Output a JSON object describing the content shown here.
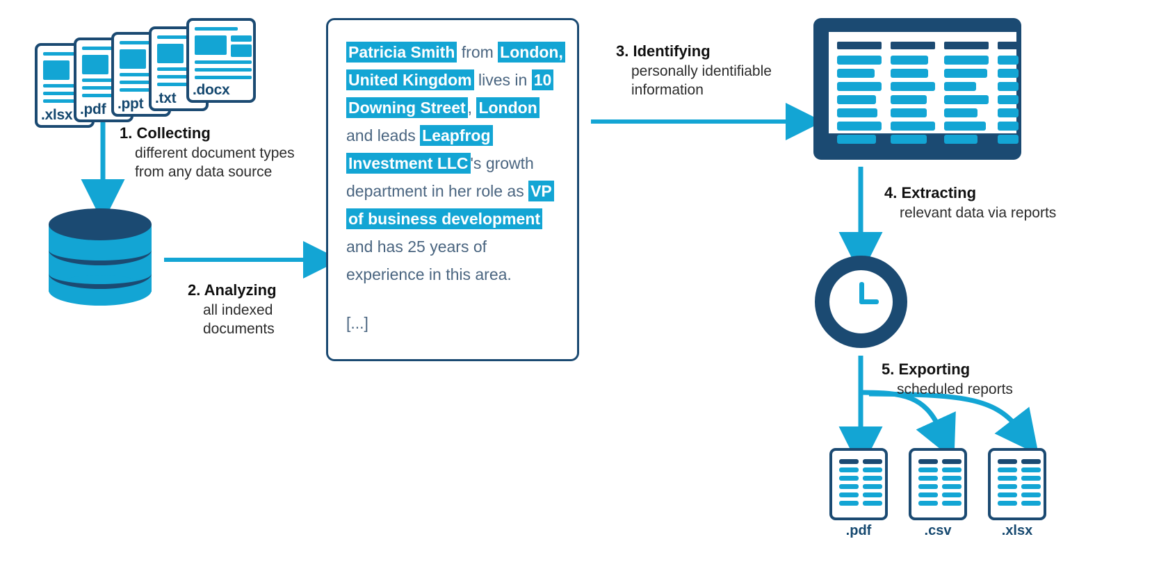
{
  "title": "Document data extraction pipeline",
  "colors": {
    "dark_blue": "#1b4a72",
    "light_blue": "#13a5d4",
    "text_dark": "#101010",
    "text_body": "#4a6580",
    "white": "#ffffff"
  },
  "input_documents": {
    "label": "document type stack",
    "files": [
      {
        "ext": ".xlsx"
      },
      {
        "ext": ".pdf"
      },
      {
        "ext": ".ppt"
      },
      {
        "ext": ".txt"
      },
      {
        "ext": ".docx"
      }
    ]
  },
  "database": {
    "label": "data source database"
  },
  "steps": [
    {
      "id": "collecting",
      "number": "1.",
      "title": "1. Collecting",
      "desc": "different document types\nfrom any data source"
    },
    {
      "id": "analyzing",
      "number": "2.",
      "title": "2. Analyzing",
      "desc": "all indexed\ndocuments"
    },
    {
      "id": "identifying",
      "number": "3.",
      "title": "3. Identifying",
      "desc": "personally identifiable\ninformation"
    },
    {
      "id": "extracting",
      "number": "4.",
      "title": "4. Extracting",
      "desc": "relevant data via reports"
    },
    {
      "id": "exporting",
      "number": "5.",
      "title": "5. Exporting",
      "desc": "scheduled reports"
    }
  ],
  "document_card": {
    "segments": [
      {
        "text": "Patricia Smith",
        "highlight": true
      },
      {
        "text": " from ",
        "highlight": false
      },
      {
        "text": "London, United Kingdom",
        "highlight": true
      },
      {
        "text": " lives in ",
        "highlight": false
      },
      {
        "text": "10 Downing Street",
        "highlight": true
      },
      {
        "text": ", ",
        "highlight": false
      },
      {
        "text": "London",
        "highlight": true
      },
      {
        "text": " and leads ",
        "highlight": false
      },
      {
        "text": "Leapfrog Investment LLC",
        "highlight": true
      },
      {
        "text": "'s growth department in her role as ",
        "highlight": false
      },
      {
        "text": "VP of business development",
        "highlight": true
      },
      {
        "text": " and has 25 years of experience in this area.",
        "highlight": false
      }
    ],
    "continuation": "[...]"
  },
  "results_table": {
    "label": "extracted results table on monitor",
    "columns": 4,
    "rows": 7
  },
  "scheduler": {
    "label": "scheduled clock"
  },
  "output_files": [
    {
      "ext": ".pdf"
    },
    {
      "ext": ".csv"
    },
    {
      "ext": ".xlsx"
    }
  ]
}
